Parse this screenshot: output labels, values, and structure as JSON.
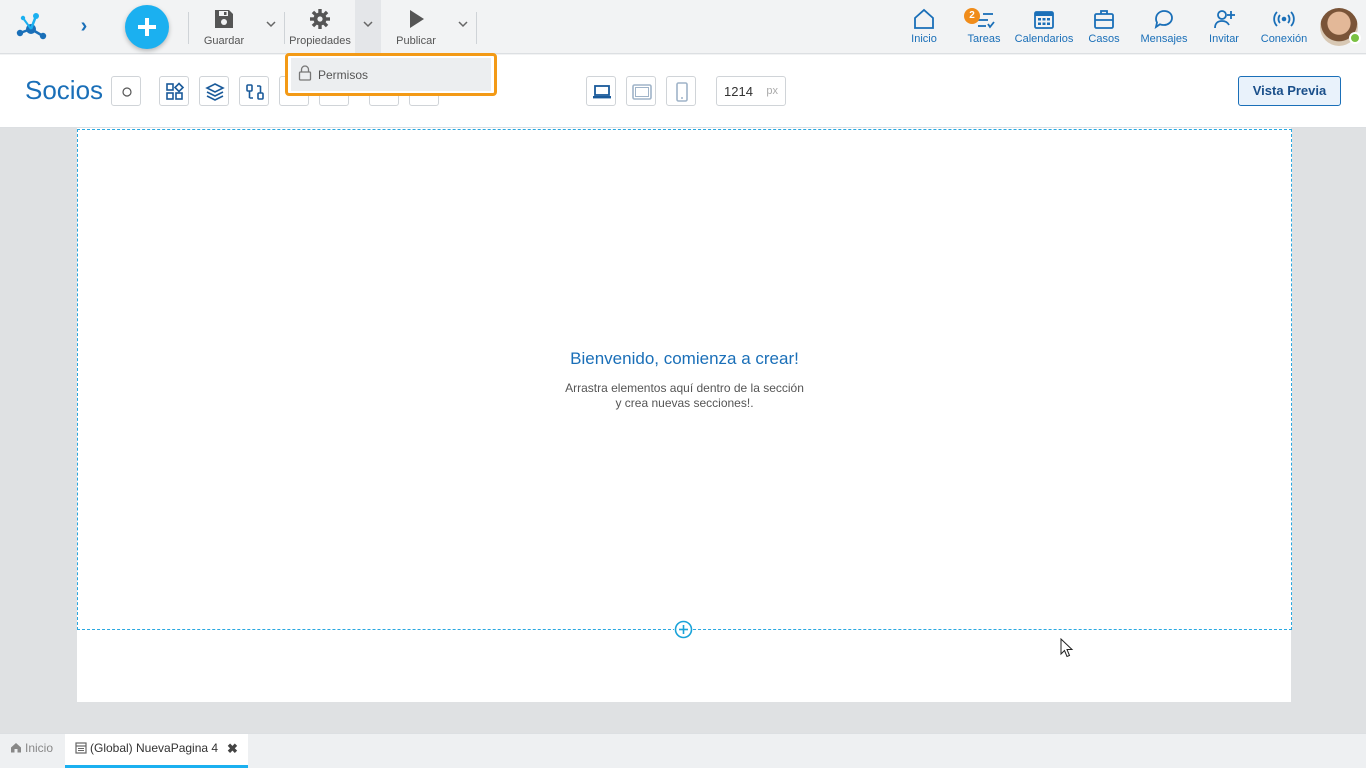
{
  "topbar": {
    "tools": {
      "save_label": "Guardar",
      "properties_label": "Propiedades",
      "publish_label": "Publicar"
    },
    "nav": [
      {
        "id": "inicio",
        "label": "Inicio",
        "icon": "home-icon"
      },
      {
        "id": "tareas",
        "label": "Tareas",
        "icon": "tasks-icon",
        "badge": "2"
      },
      {
        "id": "calendarios",
        "label": "Calendarios",
        "icon": "calendar-icon"
      },
      {
        "id": "casos",
        "label": "Casos",
        "icon": "briefcase-icon"
      },
      {
        "id": "mensajes",
        "label": "Mensajes",
        "icon": "chat-icon"
      },
      {
        "id": "invitar",
        "label": "Invitar",
        "icon": "add-user-icon"
      },
      {
        "id": "conexion",
        "label": "Conexión",
        "icon": "broadcast-icon"
      }
    ]
  },
  "subbar": {
    "title": "Socios",
    "width_value": "1214",
    "width_unit": "px",
    "preview_label": "Vista Previa"
  },
  "dropdown": {
    "items": [
      {
        "label": "Permisos",
        "icon": "lock-icon"
      }
    ]
  },
  "canvas": {
    "welcome_title": "Bienvenido, comienza a crear!",
    "welcome_line1": "Arrastra elementos aquí dentro de la sección",
    "welcome_line2": "y crea nuevas secciones!."
  },
  "tabs": {
    "home_label": "Inicio",
    "active_label": "(Global) NuevaPagina 4",
    "close_glyph": "✖"
  },
  "colors": {
    "accent": "#1bb0f0",
    "brand_blue": "#1a6fb8",
    "highlight_orange": "#f39a16",
    "badge_orange": "#f08c1a",
    "online_green": "#7ac143"
  }
}
